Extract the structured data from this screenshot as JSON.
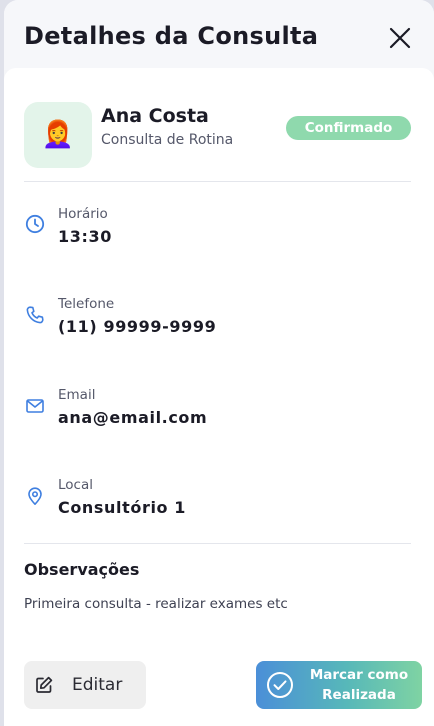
{
  "modal": {
    "title": "Detalhes da Consulta",
    "close_icon": "close-icon"
  },
  "patient": {
    "avatar_emoji": "👩‍🦰",
    "name": "Ana Costa",
    "consult_type": "Consulta de Rotina",
    "status": "Confirmado"
  },
  "details": {
    "time": {
      "label": "Horário",
      "value": "13:30",
      "icon": "clock-icon"
    },
    "phone": {
      "label": "Telefone",
      "value": "(11) 99999-9999",
      "icon": "phone-icon"
    },
    "email": {
      "label": "Email",
      "value": "ana@email.com",
      "icon": "mail-icon"
    },
    "location": {
      "label": "Local",
      "value": "Consultório 1",
      "icon": "location-pin-icon"
    }
  },
  "notes": {
    "title": "Observações",
    "text": "Primeira consulta - realizar exames etc"
  },
  "actions": {
    "edit_label": "Editar",
    "edit_icon": "edit-icon",
    "done_label_line1": "Marcar como",
    "done_label_line2": "Realizada",
    "done_icon": "check-circle-icon"
  },
  "colors": {
    "accent_blue": "#3f7fe0",
    "status_green": "#8fd9ad",
    "avatar_bg": "#e3f4ea",
    "gradient_start": "#4b8fd8",
    "gradient_end": "#7fd3a3"
  }
}
